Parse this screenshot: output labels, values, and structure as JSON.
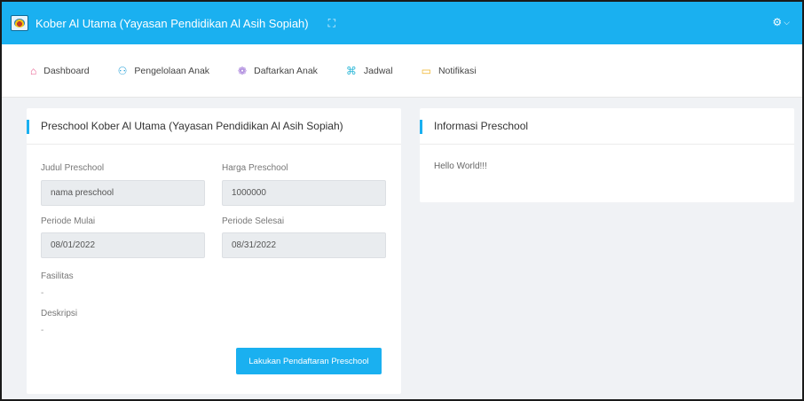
{
  "header": {
    "title": "Kober Al Utama (Yayasan Pendidikan Al Asih Sopiah)",
    "expand_icon": "expand-icon",
    "settings_icon": "gear-icon"
  },
  "nav": {
    "items": [
      {
        "label": "Dashboard",
        "icon": "home-icon"
      },
      {
        "label": "Pengelolaan Anak",
        "icon": "users-icon"
      },
      {
        "label": "Daftarkan Anak",
        "icon": "register-icon"
      },
      {
        "label": "Jadwal",
        "icon": "schedule-icon"
      },
      {
        "label": "Notifikasi",
        "icon": "notification-icon"
      }
    ]
  },
  "preschool": {
    "card_title": "Preschool Kober Al Utama (Yayasan Pendidikan Al Asih Sopiah)",
    "judul_label": "Judul Preschool",
    "judul_value": "nama preschool",
    "harga_label": "Harga Preschool",
    "harga_value": "1000000",
    "mulai_label": "Periode Mulai",
    "mulai_value": "08/01/2022",
    "selesai_label": "Periode Selesai",
    "selesai_value": "08/31/2022",
    "fasilitas_label": "Fasilitas",
    "fasilitas_value": "-",
    "deskripsi_label": "Deskripsi",
    "deskripsi_value": "-",
    "submit_label": "Lakukan Pendaftaran Preschool"
  },
  "info": {
    "card_title": "Informasi Preschool",
    "text": "Hello World!!!"
  },
  "colors": {
    "primary": "#1ab0f0",
    "background": "#f0f2f5"
  }
}
